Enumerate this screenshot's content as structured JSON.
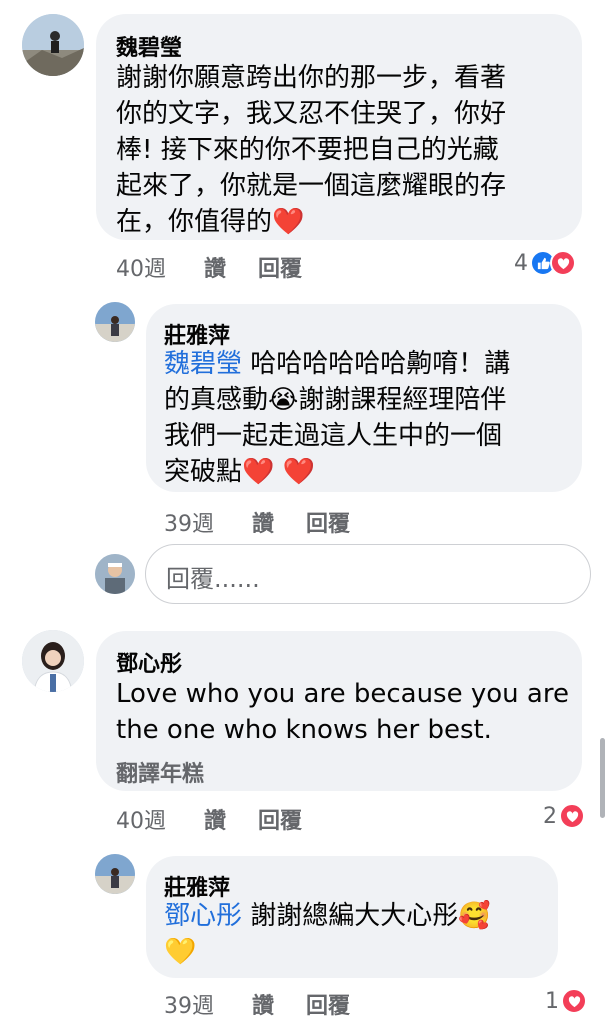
{
  "comments": [
    {
      "author": "魏碧瑩",
      "lines": [
        "謝謝你願意跨出你的那一步，看著",
        "你的文字，我又忍不住哭了，你好",
        "棒! 接下來的你不要把自己的光藏",
        "起來了，你就是一個這麼耀眼的存",
        "在，你值得的❤️"
      ],
      "time": "40週",
      "like_label": "讚",
      "reply_label": "回覆",
      "reaction_count": "4"
    },
    {
      "author": "莊雅萍",
      "mention": "魏碧瑩",
      "lines": [
        " 哈哈哈哈哈哈齁唷！講",
        "的真感動😭謝謝課程經理陪伴",
        "我們一起走過這人生中的一個",
        "突破點❤️ ❤️"
      ],
      "time": "39週",
      "like_label": "讚",
      "reply_label": "回覆"
    },
    {
      "author": "鄧心彤",
      "lines": [
        "Love who you are because you are",
        "the one who knows her best."
      ],
      "translate": "翻譯年糕",
      "time": "40週",
      "like_label": "讚",
      "reply_label": "回覆",
      "reaction_count": "2"
    },
    {
      "author": "莊雅萍",
      "mention": "鄧心彤",
      "lines": [
        " 謝謝總編大大心彤🥰",
        "💛"
      ],
      "time": "39週",
      "like_label": "讚",
      "reply_label": "回覆",
      "reaction_count": "1"
    }
  ],
  "reply_box": {
    "placeholder": "回覆......"
  },
  "colors": {
    "like": "#1877f2",
    "love": "#f33e58",
    "mention": "#216fdb",
    "bubble": "#f0f2f5"
  }
}
